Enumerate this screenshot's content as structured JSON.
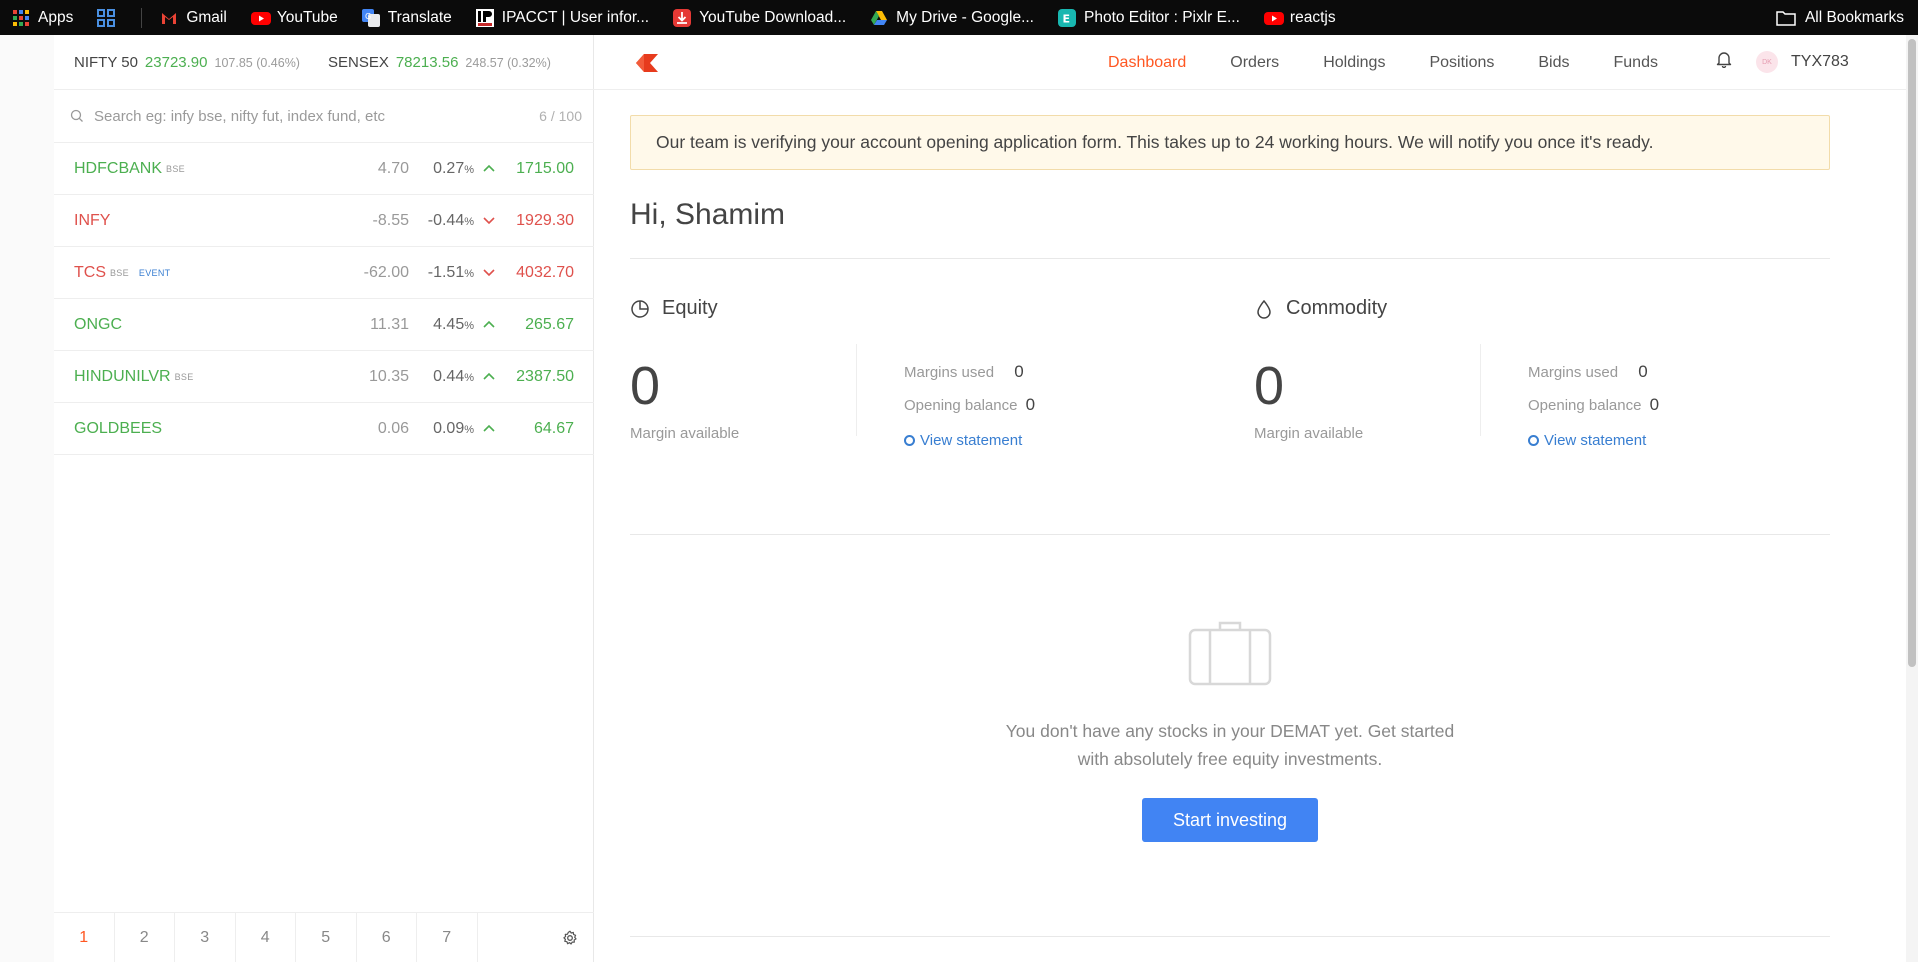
{
  "bookmarks": [
    {
      "label": "Apps",
      "icon": "apps-grid-icon"
    },
    {
      "label": "",
      "icon": "tab-group-icon"
    },
    {
      "label": "Gmail",
      "icon": "gmail-icon"
    },
    {
      "label": "YouTube",
      "icon": "youtube-icon"
    },
    {
      "label": "Translate",
      "icon": "translate-icon"
    },
    {
      "label": "IPACCT | User infor...",
      "icon": "ipacct-icon"
    },
    {
      "label": "YouTube Download...",
      "icon": "download-icon"
    },
    {
      "label": "My Drive - Google...",
      "icon": "drive-icon"
    },
    {
      "label": "Photo Editor : Pixlr E...",
      "icon": "pixlr-icon"
    },
    {
      "label": "reactjs",
      "icon": "youtube-icon"
    }
  ],
  "all_bookmarks": "All Bookmarks",
  "indices": [
    {
      "name": "NIFTY 50",
      "value": "23723.90",
      "change": "107.85 (0.46%)"
    },
    {
      "name": "SENSEX",
      "value": "78213.56",
      "change": "248.57 (0.32%)"
    }
  ],
  "search": {
    "placeholder": "Search eg: infy bse, nifty fut, index fund, etc",
    "count": "6 / 100"
  },
  "watchlist": [
    {
      "name": "HDFCBANK",
      "exchange": "BSE",
      "event": "",
      "change": "4.70",
      "pct": "0.27",
      "ltp": "1715.00",
      "dir": "up"
    },
    {
      "name": "INFY",
      "exchange": "",
      "event": "",
      "change": "-8.55",
      "pct": "-0.44",
      "ltp": "1929.30",
      "dir": "down"
    },
    {
      "name": "TCS",
      "exchange": "BSE",
      "event": "EVENT",
      "change": "-62.00",
      "pct": "-1.51",
      "ltp": "4032.70",
      "dir": "down"
    },
    {
      "name": "ONGC",
      "exchange": "",
      "event": "",
      "change": "11.31",
      "pct": "4.45",
      "ltp": "265.67",
      "dir": "up"
    },
    {
      "name": "HINDUNILVR",
      "exchange": "BSE",
      "event": "",
      "change": "10.35",
      "pct": "0.44",
      "ltp": "2387.50",
      "dir": "up"
    },
    {
      "name": "GOLDBEES",
      "exchange": "",
      "event": "",
      "change": "0.06",
      "pct": "0.09",
      "ltp": "64.67",
      "dir": "up"
    }
  ],
  "pct_sign": "%",
  "pages": [
    "1",
    "2",
    "3",
    "4",
    "5",
    "6",
    "7"
  ],
  "active_page": "1",
  "nav": {
    "items": [
      "Dashboard",
      "Orders",
      "Holdings",
      "Positions",
      "Bids",
      "Funds"
    ],
    "active": "Dashboard",
    "avatar_initials": "DK",
    "user_id": "TYX783"
  },
  "alert": "Our team is verifying your account opening application form. This takes up to 24 working hours. We will notify you once it's ready.",
  "greeting": "Hi, Shamim",
  "equity": {
    "title": "Equity",
    "margin_available": "0",
    "margin_label": "Margin available",
    "margins_used_label": "Margins used",
    "margins_used": "0",
    "opening_balance_label": "Opening balance",
    "opening_balance": "0",
    "link": "View statement"
  },
  "commodity": {
    "title": "Commodity",
    "margin_available": "0",
    "margin_label": "Margin available",
    "margins_used_label": "Margins used",
    "margins_used": "0",
    "opening_balance_label": "Opening balance",
    "opening_balance": "0",
    "link": "View statement"
  },
  "empty_state": {
    "line1": "You don't have any stocks in your DEMAT yet. Get started",
    "line2": "with absolutely free equity investments.",
    "button": "Start investing"
  },
  "colors": {
    "up": "#4caf50",
    "down": "#df514c",
    "accent": "#ff5722",
    "link": "#387ed1",
    "button": "#4184f3"
  }
}
